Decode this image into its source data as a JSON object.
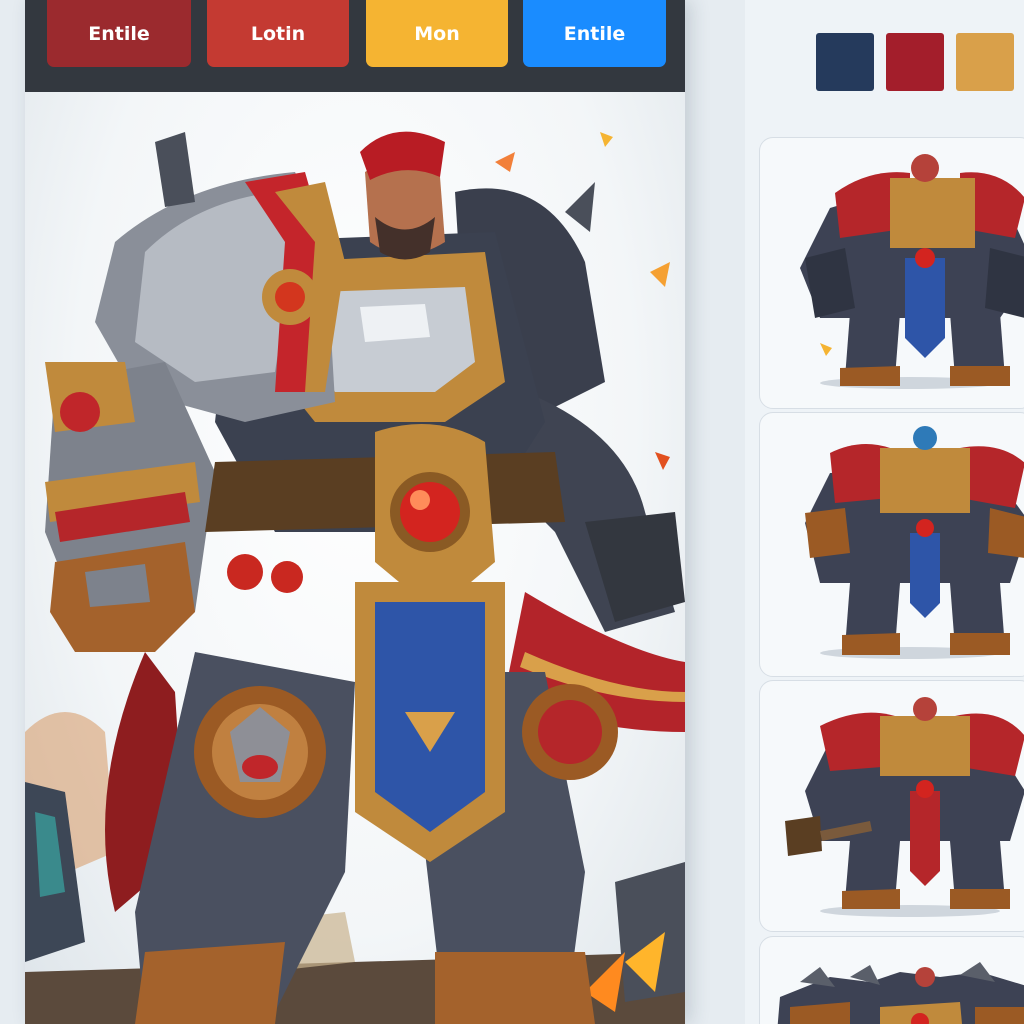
{
  "toolbar": {
    "buttons": [
      {
        "label": "Entile",
        "color": "#9b2a2e"
      },
      {
        "label": "Lotin",
        "color": "#c43a32"
      },
      {
        "label": "Mon",
        "color": "#f5b432"
      },
      {
        "label": "Entile",
        "color": "#1a8cff"
      }
    ]
  },
  "palette": {
    "swatches": [
      "#253a5c",
      "#a31e2b",
      "#d9a04a"
    ]
  },
  "hero": {
    "icon": "armored-warrior-illustration"
  },
  "variants": {
    "icon": "warrior-variant-thumbnail",
    "count": 4
  }
}
